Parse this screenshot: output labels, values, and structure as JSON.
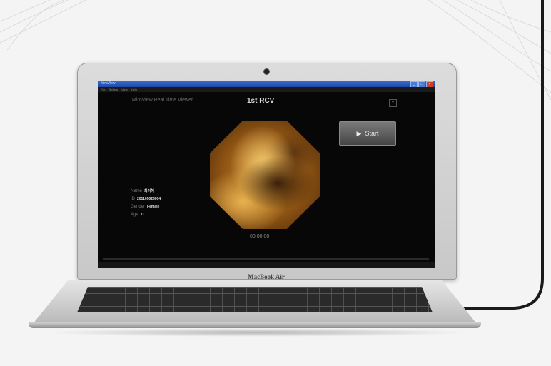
{
  "window": {
    "titlebar_text": "MiroView",
    "menus": [
      "File",
      "Setting",
      "View",
      "Help"
    ],
    "controls": [
      "_",
      "□",
      "×"
    ]
  },
  "viewer": {
    "app_title": "MiroView Real Time Viewer",
    "page_title": "1st RCV",
    "close_label": "×",
    "start_label": "Start",
    "timer": "00:00:00",
    "progress_fraction": 0
  },
  "patient": {
    "name_label": "Name",
    "name_value": "최이혜",
    "id_label": "ID",
    "id_value": "201109023004",
    "gender_label": "Gender",
    "gender_value": "Female",
    "age_label": "Age",
    "age_value": "11"
  },
  "laptop": {
    "brand": "MacBook Air"
  },
  "colors": {
    "titlebar": "#1c47a8",
    "screen_bg": "#070707",
    "start_button": "#5a5a5a"
  },
  "icons": {
    "play": "play-icon",
    "close": "close-icon"
  }
}
